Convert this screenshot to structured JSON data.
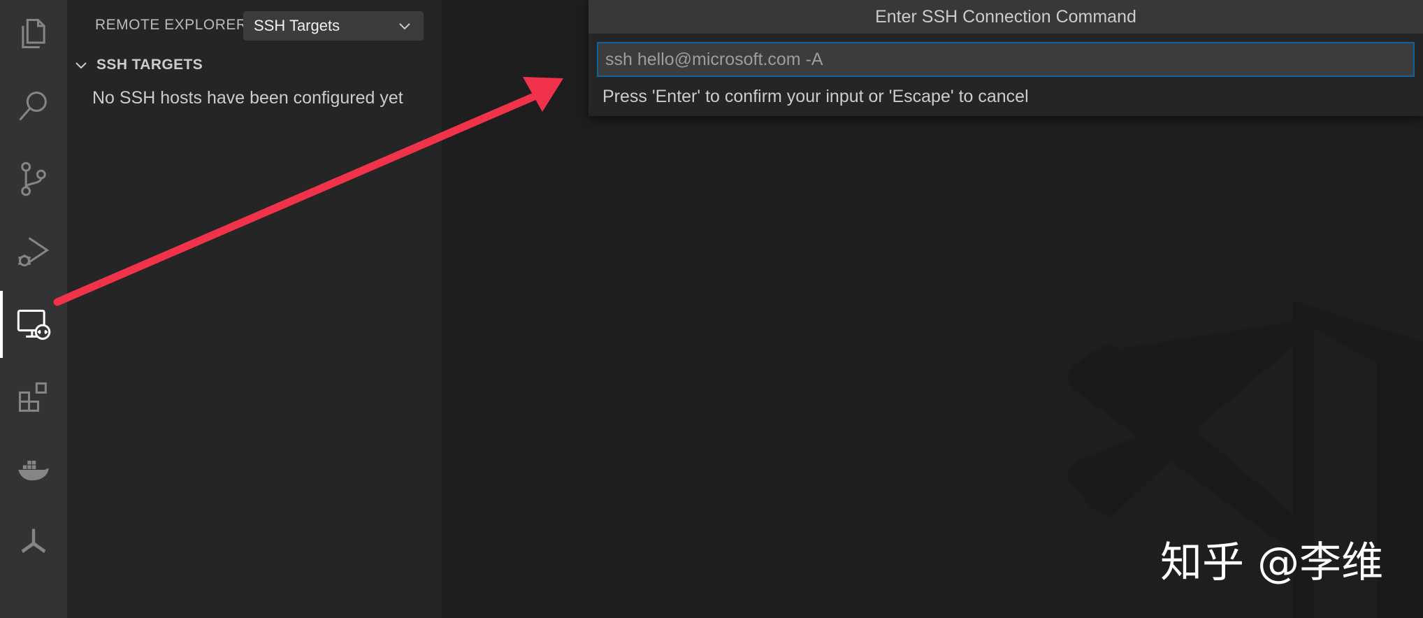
{
  "sidebar": {
    "title": "REMOTE EXPLORER",
    "target_select": {
      "value": "SSH Targets"
    },
    "section": {
      "title": "SSH TARGETS",
      "empty_message": "No SSH hosts have been configured yet"
    }
  },
  "activity_bar": {
    "items": [
      {
        "icon": "explorer-icon"
      },
      {
        "icon": "search-icon"
      },
      {
        "icon": "source-control-icon"
      },
      {
        "icon": "run-debug-icon"
      },
      {
        "icon": "remote-explorer-icon",
        "active": true
      },
      {
        "icon": "extensions-icon"
      },
      {
        "icon": "docker-icon"
      },
      {
        "icon": "kubernetes-helm-icon"
      }
    ]
  },
  "quick_input": {
    "title": "Enter SSH Connection Command",
    "placeholder": "ssh hello@microsoft.com -A",
    "value": "",
    "hint": "Press 'Enter' to confirm your input or 'Escape' to cancel"
  },
  "watermark": {
    "text": "知乎 @李维"
  },
  "colors": {
    "activity_bar": "#333333",
    "sidebar": "#252526",
    "editor": "#1e1e1e",
    "focus_border": "#0e639c",
    "annotation_arrow": "#f0334a"
  }
}
